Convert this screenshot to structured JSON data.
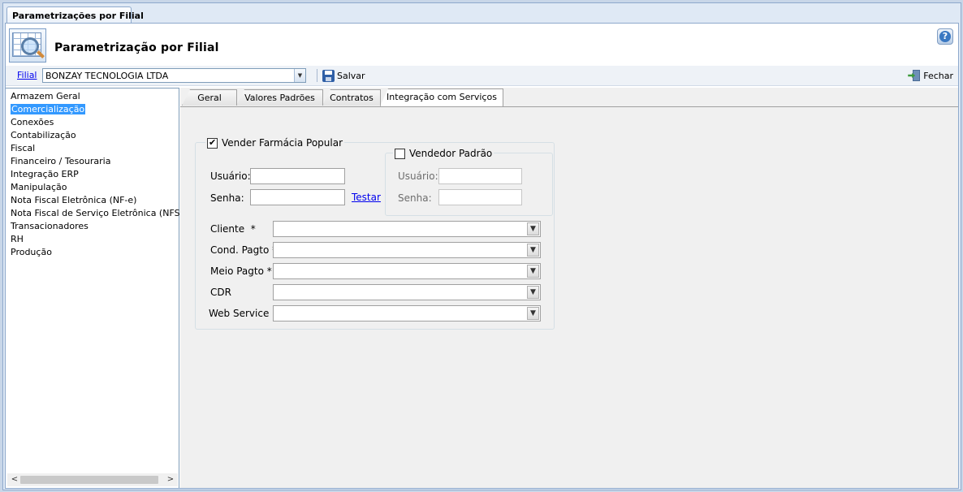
{
  "window": {
    "doc_tab": "Parametrizações por Filial"
  },
  "header": {
    "title": "Parametrização por Filial",
    "help_icon": "help-icon"
  },
  "toolbar": {
    "filial_label": "Filial",
    "filial_value": "BONZAY TECNOLOGIA LTDA",
    "save_label": "Salvar",
    "close_label": "Fechar"
  },
  "sidebar": {
    "items": [
      "Armazem Geral",
      "Comercialização",
      "Conexões",
      "Contabilização",
      "Fiscal",
      "Financeiro / Tesouraria",
      "Integração ERP",
      "Manipulação",
      "Nota Fiscal Eletrônica (NF-e)",
      "Nota Fiscal de Serviço Eletrônica (NFS-e)",
      "Transacionadores",
      "RH",
      "Produção"
    ],
    "selected": "Comercialização"
  },
  "tabs": [
    "Geral",
    "Valores Padrões",
    "Contratos",
    "Integração com Serviços"
  ],
  "active_tab": "Integração com Serviços",
  "form": {
    "farmacia_popular": {
      "label": "Vender Farmácia Popular",
      "checked": true
    },
    "usuario_label": "Usuário:",
    "senha_label": "Senha:",
    "usuario_value": "",
    "senha_value": "",
    "testar_label": "Testar",
    "vendedor_padrao": {
      "label": "Vendedor Padrão",
      "checked": false,
      "usuario_label": "Usuário:",
      "senha_label": "Senha:"
    },
    "fields": {
      "cliente": "Cliente",
      "cond_pagto": "Cond. Pagto",
      "meio_pagto": "Meio Pagto",
      "cdr": "CDR",
      "web_service": "Web Service"
    },
    "required_mark": "*"
  }
}
